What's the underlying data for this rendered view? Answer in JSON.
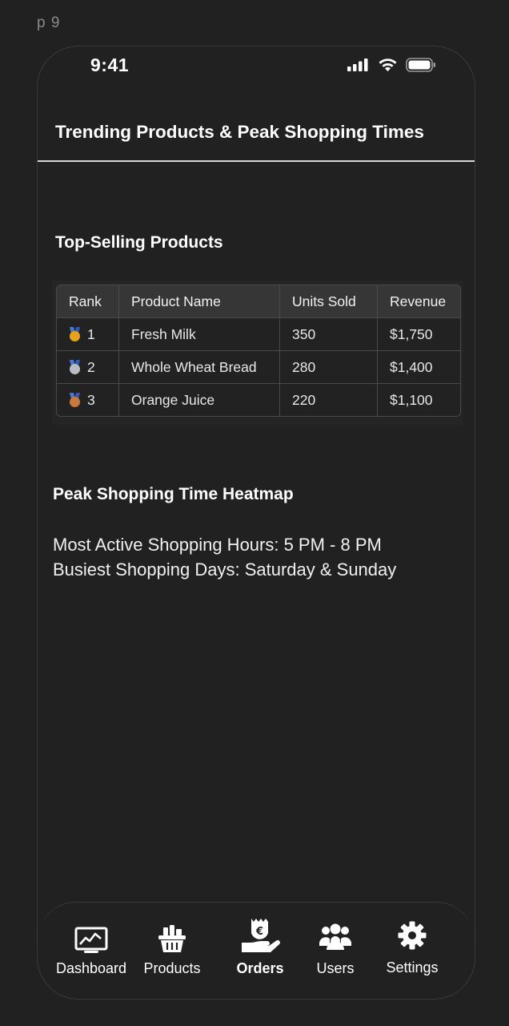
{
  "frame_label": "p 9",
  "status_bar": {
    "time": "9:41",
    "icons": [
      "cellular-signal-icon",
      "wifi-icon",
      "battery-icon"
    ]
  },
  "header": {
    "title": "Trending Products & Peak Shopping Times"
  },
  "top_selling": {
    "title": "Top-Selling Products",
    "columns": [
      "Rank",
      "Product Name",
      "Units Sold",
      "Revenue"
    ],
    "rows": [
      {
        "medal": "gold",
        "rank": "1",
        "product": "Fresh Milk",
        "units": "350",
        "revenue": "$1,750"
      },
      {
        "medal": "silver",
        "rank": "2",
        "product": "Whole Wheat Bread",
        "units": "280",
        "revenue": "$1,400"
      },
      {
        "medal": "bronze",
        "rank": "3",
        "product": "Orange Juice",
        "units": "220",
        "revenue": "$1,100"
      }
    ]
  },
  "heatmap": {
    "title": "Peak Shopping Time Heatmap",
    "most_active_hours": "Most Active Shopping Hours: 5 PM - 8 PM",
    "busiest_days": "Busiest Shopping Days: Saturday & Sunday"
  },
  "tab_bar": {
    "active": "orders",
    "tabs": [
      {
        "id": "dashboard",
        "label": "Dashboard",
        "icon": "chart-monitor-icon"
      },
      {
        "id": "products",
        "label": "Products",
        "icon": "grocery-basket-icon"
      },
      {
        "id": "orders",
        "label": "Orders",
        "icon": "euro-hand-icon"
      },
      {
        "id": "users",
        "label": "Users",
        "icon": "users-group-icon"
      },
      {
        "id": "settings",
        "label": "Settings",
        "icon": "gear-icon"
      }
    ]
  },
  "colors": {
    "background": "#212121",
    "text": "#ffffff",
    "divider": "#d9d9d9",
    "medal_gold": "#e8a317",
    "medal_silver": "#b8bcc4",
    "medal_bronze": "#c97a3a"
  }
}
